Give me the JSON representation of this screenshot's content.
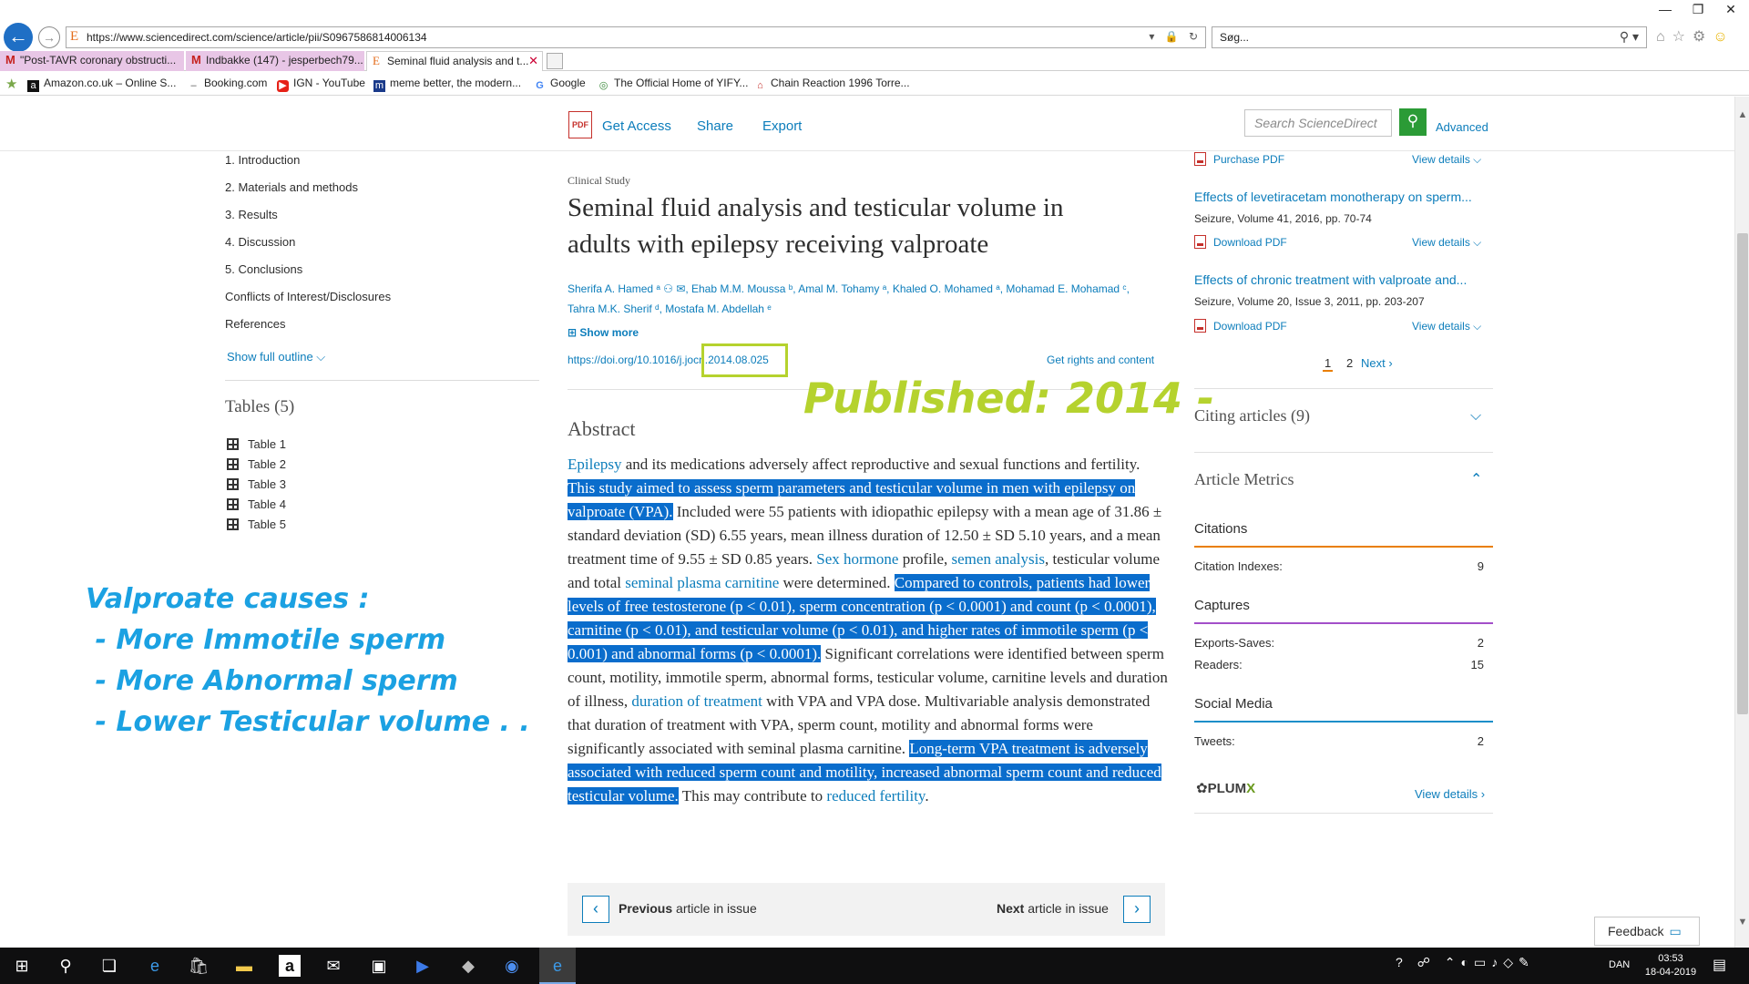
{
  "browser": {
    "url": "https://www.sciencedirect.com/science/article/pii/S0967586814006134",
    "search_placeholder": "Søg...",
    "tabs": [
      {
        "label": "\"Post-TAVR coronary obstructi..."
      },
      {
        "label": "Indbakke (147) - jesperbech79..."
      },
      {
        "label": "Seminal fluid analysis and t..."
      }
    ],
    "favorites": [
      {
        "label": "Amazon.co.uk – Online S..."
      },
      {
        "label": "Booking.com"
      },
      {
        "label": "IGN - YouTube"
      },
      {
        "label": "meme better, the modern..."
      },
      {
        "label": "Google"
      },
      {
        "label": "The Official Home of YIFY..."
      },
      {
        "label": "Chain Reaction 1996 Torre..."
      }
    ]
  },
  "header": {
    "get_access": "Get Access",
    "share": "Share",
    "export": "Export",
    "search_placeholder": "Search ScienceDirect",
    "advanced": "Advanced"
  },
  "outline": {
    "items": [
      "1. Introduction",
      "2. Materials and methods",
      "3. Results",
      "4. Discussion",
      "5. Conclusions",
      "Conflicts of Interest/Disclosures",
      "References"
    ],
    "show_full_outline": "Show full outline",
    "tables_heading": "Tables (5)",
    "tables": [
      "Table 1",
      "Table 2",
      "Table 3",
      "Table 4",
      "Table 5"
    ]
  },
  "annotation": {
    "line1": "Valproate causes :",
    "line2": " - More Immotile sperm",
    "line3": " - More Abnormal sperm",
    "line4": " - Lower Testicular volume . .",
    "published": "Published: 2014 -"
  },
  "article": {
    "type": "Clinical Study",
    "title": "Seminal fluid analysis and testicular volume in adults with epilepsy receiving valproate",
    "authors_line1": "Sherifa A. Hamed ᵃ ⚇ ✉, Ehab M.M. Moussa ᵇ, Amal M. Tohamy ᵃ, Khaled O. Mohamed ᵃ, Mohamad E. Mohamad ᶜ,",
    "authors_line2": "Tahra M.K. Sherif ᵈ, Mostafa M. Abdellah ᵉ",
    "show_more": "⊞ Show more",
    "doi": "https://doi.org/10.1016/j.jocn.2014.08.025",
    "rights": "Get rights and content",
    "abstract_heading": "Abstract",
    "abstract": {
      "s1_link": "Epilepsy",
      "s1_rest": " and its medications adversely affect reproductive and sexual functions and fertility. ",
      "hl1": "This study aimed to assess sperm parameters and testicular volume in men with epilepsy on valproate (VPA).",
      "s2": " Included were 55 patients with idiopathic epilepsy with a mean age of 31.86 ± standard deviation (SD) 6.55 years, mean illness duration of 12.50 ± SD 5.10 years, and a mean treatment time of 9.55 ± SD 0.85 years. ",
      "link_sex_hormone": "Sex hormone",
      "s3": " profile, ",
      "link_semen": "semen analysis",
      "s4": ", testicular volume and total ",
      "link_carnitine": "seminal plasma carnitine",
      "s5": " were determined. ",
      "hl2": "Compared to controls, patients had lower levels of free testosterone (p < 0.01), sperm concentration (p < 0.0001) and count (p < 0.0001), carnitine (p < 0.01), and testicular volume (p < 0.01), and higher rates of immotile sperm (p < 0.001) and abnormal forms (p < 0.0001).",
      "s6": " Significant correlations were identified between sperm count, motility, immotile sperm, abnormal forms, testicular volume, carnitine levels and duration of illness, ",
      "link_duration": "duration of treatment",
      "s7": " with VPA and VPA dose. Multivariable analysis demonstrated that duration of treatment with VPA, sperm count, motility and abnormal forms were significantly associated with seminal plasma carnitine. ",
      "hl3": "Long-term VPA treatment is adversely associated with reduced sperm count and motility, increased abnormal sperm count and reduced testicular volume.",
      "s8": " This may contribute to ",
      "link_fertility": "reduced fertility",
      "s9": "."
    },
    "prev_bold": "Previous",
    "prev_rest": " article in issue",
    "next_bold": "Next",
    "next_rest": " article in issue"
  },
  "recommended": {
    "top_purchase": "Purchase PDF",
    "top_view": "View details ⌵",
    "items": [
      {
        "title": "Effects of levetiracetam monotherapy on sperm...",
        "meta": "Seizure, Volume 41, 2016, pp. 70-74",
        "pdf": "Download PDF",
        "view": "View details ⌵"
      },
      {
        "title": "Effects of chronic treatment with valproate and...",
        "meta": "Seizure, Volume 20, Issue 3, 2011, pp. 203-207",
        "pdf": "Download PDF",
        "view": "View details ⌵"
      }
    ],
    "page1": "1",
    "page2": "2",
    "next": "Next ›"
  },
  "citing": {
    "heading": "Citing articles (9)"
  },
  "metrics": {
    "heading": "Article Metrics",
    "citations_h": "Citations",
    "citation_indexes_label": "Citation Indexes:",
    "citation_indexes_value": "9",
    "captures_h": "Captures",
    "exports_label": "Exports-Saves:",
    "exports_value": "2",
    "readers_label": "Readers:",
    "readers_value": "15",
    "social_h": "Social Media",
    "tweets_label": "Tweets:",
    "tweets_value": "2",
    "plumx_a": "✿PLUM",
    "plumx_b": "X",
    "view_details": "View details ›",
    "colors": {
      "citations": "#e97e00",
      "captures": "#a34fc9",
      "social": "#1b8ec9"
    }
  },
  "feedback": "Feedback",
  "taskbar": {
    "lang": "DAN",
    "time": "03:53",
    "date": "18-04-2019"
  }
}
